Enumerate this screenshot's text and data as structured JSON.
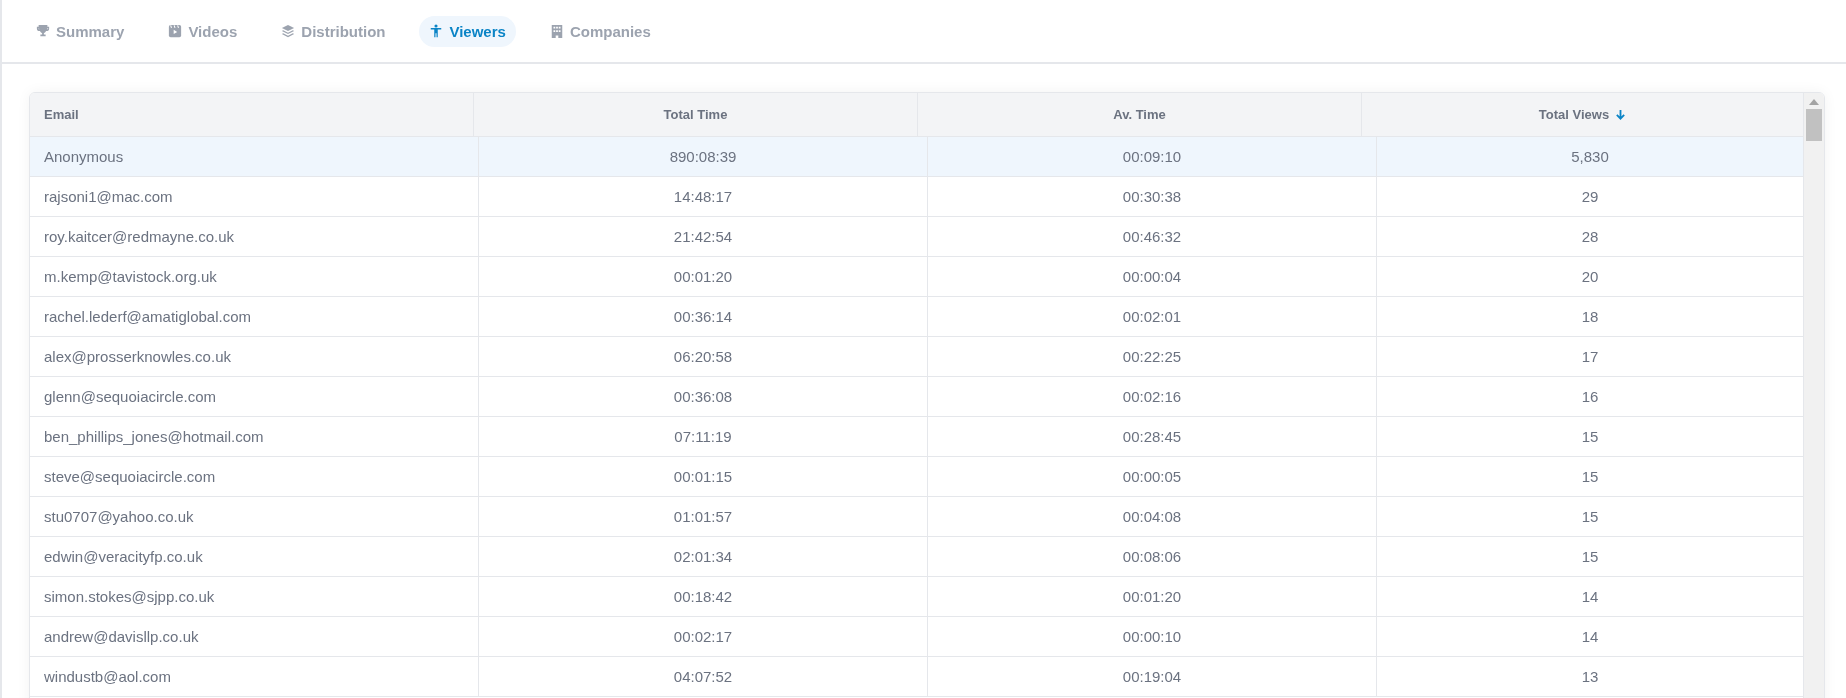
{
  "tabs": [
    {
      "label": "Summary",
      "selected": false
    },
    {
      "label": "Videos",
      "selected": false
    },
    {
      "label": "Distribution",
      "selected": false
    },
    {
      "label": "Viewers",
      "selected": true
    },
    {
      "label": "Companies",
      "selected": false
    }
  ],
  "table": {
    "columns": [
      {
        "label": "Email",
        "sorted": false
      },
      {
        "label": "Total Time",
        "sorted": false
      },
      {
        "label": "Av. Time",
        "sorted": false
      },
      {
        "label": "Total Views",
        "sorted": true
      }
    ],
    "rows": [
      {
        "selected": true,
        "cells": [
          "Anonymous",
          "890:08:39",
          "00:09:10",
          "5,830"
        ]
      },
      {
        "selected": false,
        "cells": [
          "rajsoni1@mac.com",
          "14:48:17",
          "00:30:38",
          "29"
        ]
      },
      {
        "selected": false,
        "cells": [
          "roy.kaitcer@redmayne.co.uk",
          "21:42:54",
          "00:46:32",
          "28"
        ]
      },
      {
        "selected": false,
        "cells": [
          "m.kemp@tavistock.org.uk",
          "00:01:20",
          "00:00:04",
          "20"
        ]
      },
      {
        "selected": false,
        "cells": [
          "rachel.lederf@amatiglobal.com",
          "00:36:14",
          "00:02:01",
          "18"
        ]
      },
      {
        "selected": false,
        "cells": [
          "alex@prosserknowles.co.uk",
          "06:20:58",
          "00:22:25",
          "17"
        ]
      },
      {
        "selected": false,
        "cells": [
          "glenn@sequoiacircle.com",
          "00:36:08",
          "00:02:16",
          "16"
        ]
      },
      {
        "selected": false,
        "cells": [
          "ben_phillips_jones@hotmail.com",
          "07:11:19",
          "00:28:45",
          "15"
        ]
      },
      {
        "selected": false,
        "cells": [
          "steve@sequoiacircle.com",
          "00:01:15",
          "00:00:05",
          "15"
        ]
      },
      {
        "selected": false,
        "cells": [
          "stu0707@yahoo.co.uk",
          "01:01:57",
          "00:04:08",
          "15"
        ]
      },
      {
        "selected": false,
        "cells": [
          "edwin@veracityfp.co.uk",
          "02:01:34",
          "00:08:06",
          "15"
        ]
      },
      {
        "selected": false,
        "cells": [
          "simon.stokes@sjpp.co.uk",
          "00:18:42",
          "00:01:20",
          "14"
        ]
      },
      {
        "selected": false,
        "cells": [
          "andrew@davisllp.co.uk",
          "00:02:17",
          "00:00:10",
          "14"
        ]
      },
      {
        "selected": false,
        "cells": [
          "windustb@aol.com",
          "04:07:52",
          "00:19:04",
          "13"
        ]
      }
    ]
  }
}
